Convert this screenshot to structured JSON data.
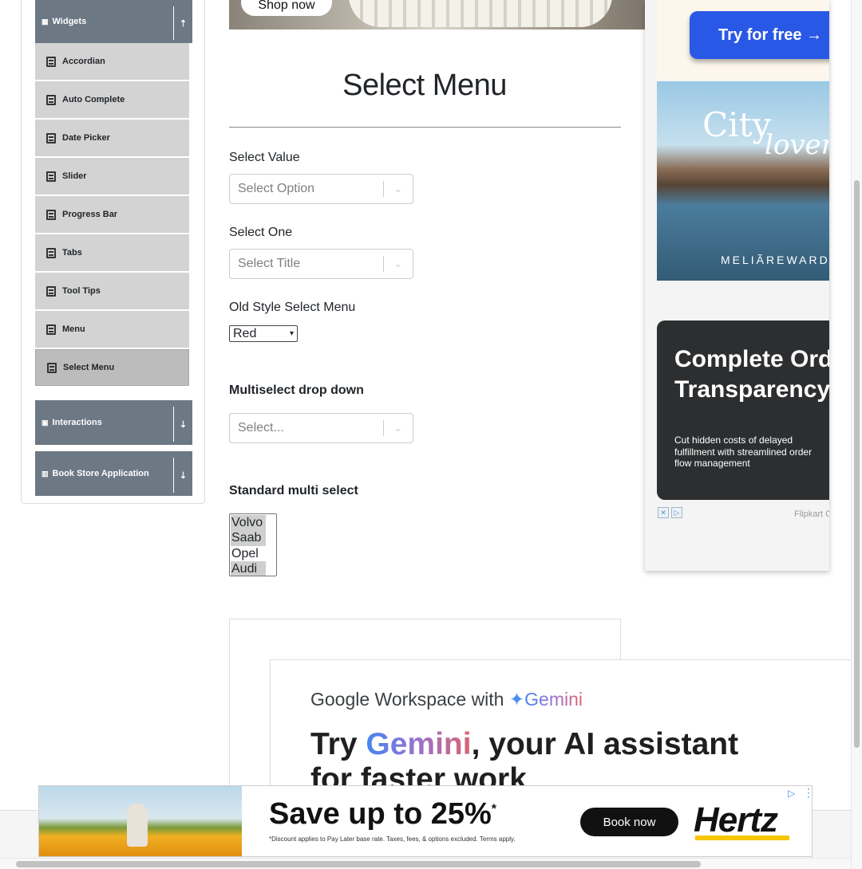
{
  "sidebar": {
    "widgets_header": "Widgets",
    "items": [
      {
        "label": "Accordian"
      },
      {
        "label": "Auto Complete"
      },
      {
        "label": "Date Picker"
      },
      {
        "label": "Slider"
      },
      {
        "label": "Progress Bar"
      },
      {
        "label": "Tabs"
      },
      {
        "label": "Tool Tips"
      },
      {
        "label": "Menu"
      },
      {
        "label": "Select Menu"
      }
    ],
    "interactions_header": "Interactions",
    "bookstore_header": "Book Store Application"
  },
  "banner": {
    "shop_label": "Shop now"
  },
  "main": {
    "title": "Select Menu",
    "select_value": {
      "label": "Select Value",
      "placeholder": "Select Option"
    },
    "select_one": {
      "label": "Select One",
      "placeholder": "Select Title"
    },
    "old_style": {
      "label": "Old Style Select Menu",
      "value": "Red"
    },
    "multiselect": {
      "label": "Multiselect drop down",
      "placeholder": "Select..."
    },
    "standard_multi": {
      "label": "Standard multi select",
      "options": [
        "Volvo",
        "Saab",
        "Opel",
        "Audi"
      ],
      "selected": [
        "Volvo",
        "Saab",
        "Audi"
      ]
    }
  },
  "ads": {
    "try_button": "Try for free →",
    "city_word1": "City",
    "city_word2": "lovers",
    "melia": "MELIÃREWARDS",
    "order_title_1": "Complete Order",
    "order_title_2": "Transparency",
    "order_text": "Cut hidden costs of delayed fulfillment with streamlined order flow management",
    "flipkart": "Flipkart Commerce",
    "gemini_head_prefix": "Google Workspace with ",
    "gemini_word": "Gemini",
    "gemini_big_prefix": "Try ",
    "gemini_big_word": "Gemini",
    "gemini_big_suffix": ", your AI assistant",
    "gemini_big_line2": "for faster work",
    "hertz_save": "Save up to 25%",
    "hertz_fine": "*Discount applies to Pay Later base rate. Taxes, fees, & options excluded. Terms apply.",
    "hertz_book": "Book now",
    "hertz_logo": "Hertz"
  }
}
